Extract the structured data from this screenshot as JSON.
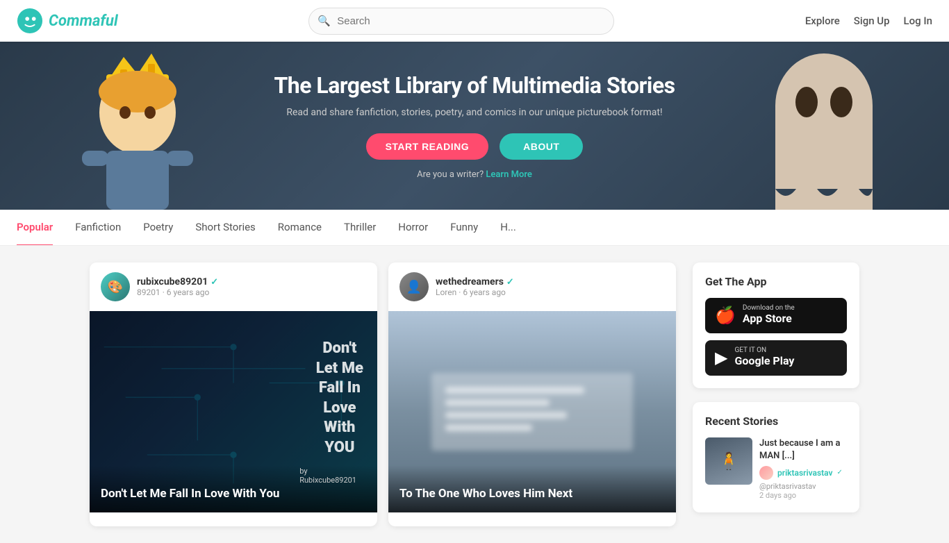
{
  "header": {
    "logo_text": "Commaful",
    "search_placeholder": "Search",
    "nav": {
      "explore": "Explore",
      "signup": "Sign Up",
      "login": "Log In"
    }
  },
  "hero": {
    "title": "The Largest Library of Multimedia Stories",
    "subtitle": "Read and share fanfiction, stories, poetry, and comics in our unique picturebook format!",
    "btn_start": "START READING",
    "btn_about": "ABOUT",
    "writer_prompt": "Are you a writer?",
    "learn_more": "Learn More"
  },
  "categories": [
    {
      "label": "Popular",
      "active": true
    },
    {
      "label": "Fanfiction",
      "active": false
    },
    {
      "label": "Poetry",
      "active": false
    },
    {
      "label": "Short Stories",
      "active": false
    },
    {
      "label": "Romance",
      "active": false
    },
    {
      "label": "Thriller",
      "active": false
    },
    {
      "label": "Horror",
      "active": false
    },
    {
      "label": "Funny",
      "active": false
    },
    {
      "label": "H...",
      "active": false
    }
  ],
  "stories": [
    {
      "username": "rubixcube89201",
      "verified": true,
      "meta": "89201 · 6 years ago",
      "title": "Don't Let Me Fall In Love With You",
      "image_text": "Don't\nLet Me\nFall In\nLove\nWith\nYOU"
    },
    {
      "username": "wethedreamers",
      "verified": true,
      "loren": "Loren",
      "meta": "Loren · 6 years ago",
      "title": "To The One Who Loves Him Next"
    }
  ],
  "sidebar": {
    "app_section_title": "Get The App",
    "app_store_label_small": "Download on the",
    "app_store_label_big": "App Store",
    "google_play_label_small": "GET IT ON",
    "google_play_label_big": "Google Play",
    "recent_title": "Recent Stories",
    "recent_story": {
      "title": "Just because I am a MAN [...]",
      "author": "priktasrivastav",
      "handle": "@priktasrivastav",
      "verified": true,
      "time": "2 days ago"
    }
  }
}
